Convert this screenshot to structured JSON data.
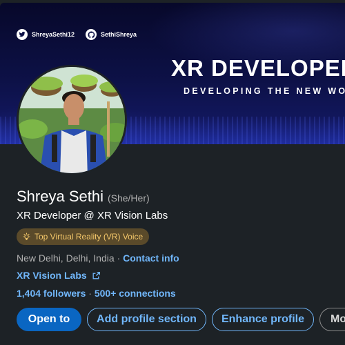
{
  "banner": {
    "twitter_handle": "ShreyaSethi12",
    "github_handle": "SethiShreya",
    "title": "XR DEVELOPER",
    "subtitle": "DEVELOPING THE NEW WORLD"
  },
  "profile": {
    "name": "Shreya Sethi",
    "pronouns": "(She/Her)",
    "headline": "XR Developer @ XR Vision Labs",
    "badge": "Top Virtual Reality (VR) Voice",
    "location": "New Delhi, Delhi, India",
    "location_sep": "·",
    "contact_link": "Contact info",
    "company": "XR Vision Labs",
    "followers": "1,404 followers",
    "stats_sep": "·",
    "connections": "500+ connections"
  },
  "actions": {
    "open_to": "Open to",
    "add_section": "Add profile section",
    "enhance": "Enhance profile",
    "more": "More"
  },
  "colors": {
    "background": "#1d2226",
    "link": "#71b7fb",
    "primary_button": "#0a66c2",
    "badge_bg": "#5a4a2a",
    "badge_text": "#f5c86b"
  }
}
